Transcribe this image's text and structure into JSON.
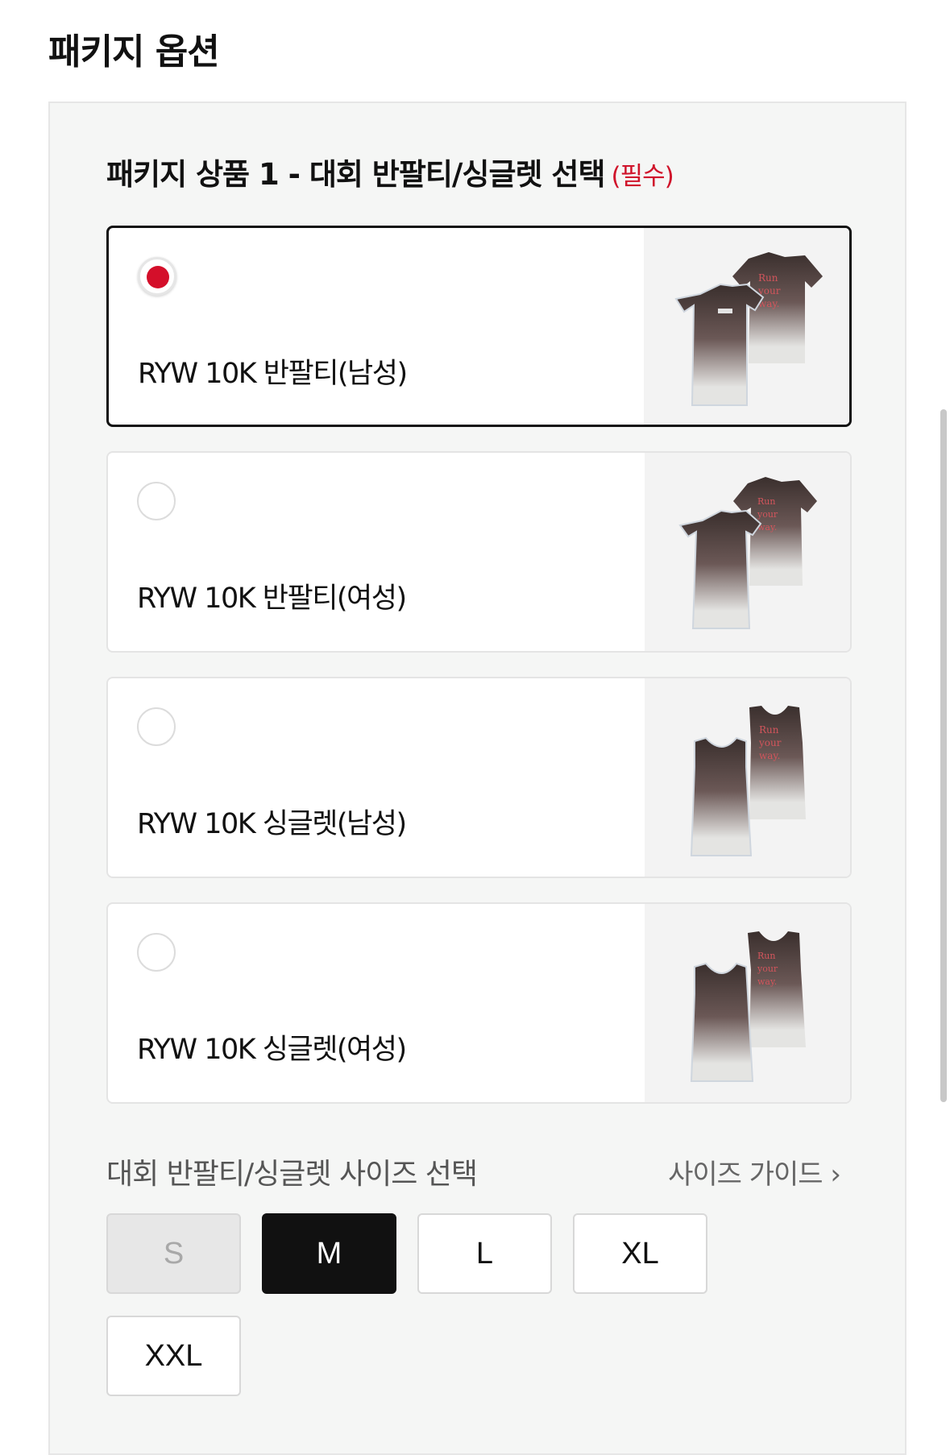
{
  "page_title": "패키지 옵션",
  "section": {
    "title": "패키지 상품 1 - 대회 반팔티/싱글렛 선택",
    "required": "(필수)"
  },
  "options": [
    {
      "label": "RYW 10K 반팔티(남성)",
      "selected": true,
      "image": "tshirt-men-image"
    },
    {
      "label": "RYW 10K 반팔티(여성)",
      "selected": false,
      "image": "tshirt-women-image"
    },
    {
      "label": "RYW 10K 싱글렛(남성)",
      "selected": false,
      "image": "singlet-men-image"
    },
    {
      "label": "RYW 10K 싱글렛(여성)",
      "selected": false,
      "image": "singlet-women-image"
    }
  ],
  "size": {
    "title": "대회 반팔티/싱글렛 사이즈 선택",
    "guide": "사이즈 가이드 ›",
    "buttons": [
      {
        "label": "S",
        "state": "disabled"
      },
      {
        "label": "M",
        "state": "selected"
      },
      {
        "label": "L",
        "state": "default"
      },
      {
        "label": "XL",
        "state": "default"
      },
      {
        "label": "XXL",
        "state": "default"
      }
    ]
  },
  "colors": {
    "accent": "#d40f2a",
    "selected_bg": "#111111",
    "panel_bg": "#f5f6f5"
  }
}
